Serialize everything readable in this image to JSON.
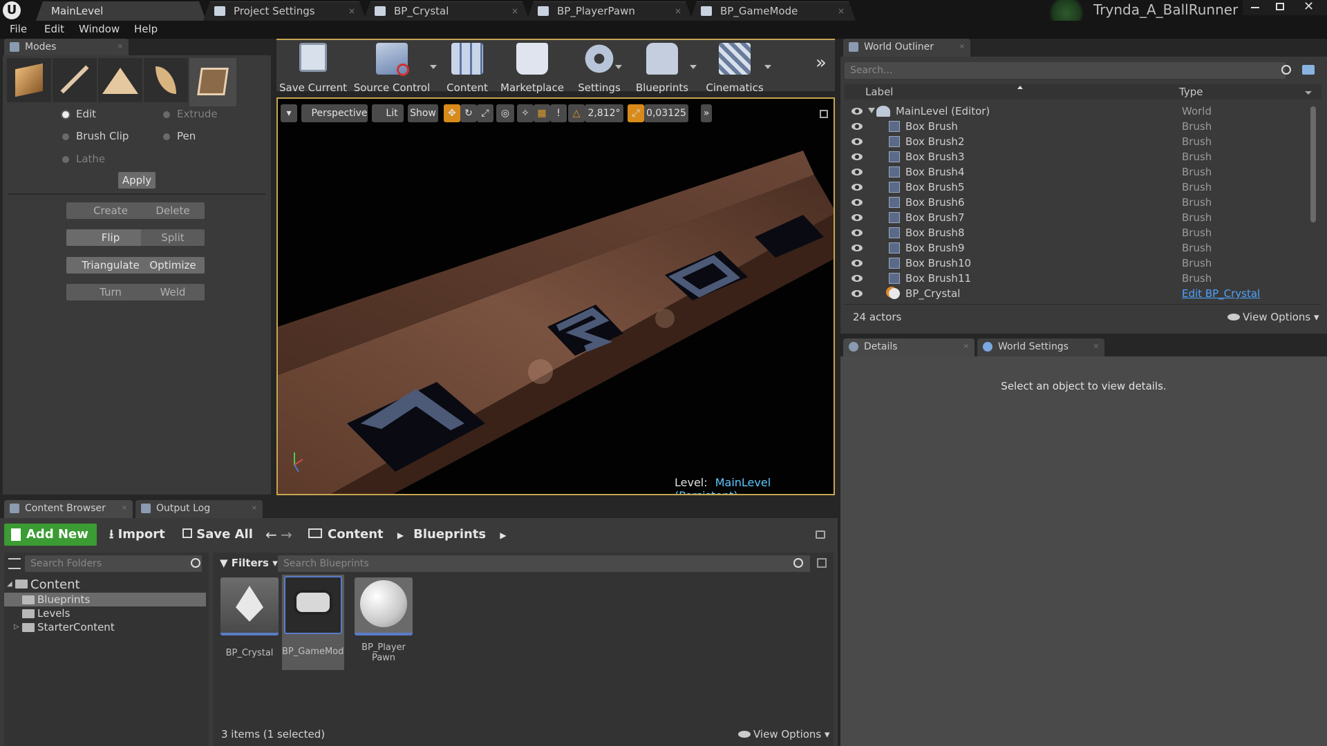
{
  "window": {
    "tabs": [
      {
        "label": "MainLevel",
        "active": true
      },
      {
        "label": "Project Settings",
        "active": false
      },
      {
        "label": "BP_Crystal",
        "active": false
      },
      {
        "label": "BP_PlayerPawn",
        "active": false
      },
      {
        "label": "BP_GameMode",
        "active": false
      }
    ],
    "project_name": "Trynda_A_BallRunner"
  },
  "menu": [
    "File",
    "Edit",
    "Window",
    "Help"
  ],
  "modes": {
    "tab_label": "Modes",
    "mode_icons": [
      "placement-mode-icon",
      "paint-mode-icon",
      "landscape-mode-icon",
      "foliage-mode-icon",
      "geometry-mode-icon"
    ],
    "radios": {
      "edit": "Edit",
      "extrude": "Extrude",
      "brush_clip": "Brush Clip",
      "pen": "Pen",
      "lathe": "Lathe"
    },
    "apply": "Apply",
    "buttons": {
      "create": "Create",
      "delete": "Delete",
      "flip": "Flip",
      "split": "Split",
      "triangulate": "Triangulate",
      "optimize": "Optimize",
      "turn": "Turn",
      "weld": "Weld"
    }
  },
  "toolbar": {
    "save_current": "Save Current",
    "source_control": "Source Control",
    "content": "Content",
    "marketplace": "Marketplace",
    "settings": "Settings",
    "blueprints": "Blueprints",
    "cinematics": "Cinematics"
  },
  "viewport": {
    "perspective": "Perspective",
    "lit": "Lit",
    "show": "Show",
    "rotation_snap": "2,812°",
    "scale_snap": "0,03125",
    "level_label": "Level:",
    "level_name": "MainLevel (Persistent)"
  },
  "outliner": {
    "tab_label": "World Outliner",
    "search_placeholder": "Search...",
    "col_label": "Label",
    "col_type": "Type",
    "root": {
      "label": "MainLevel (Editor)",
      "type": "World"
    },
    "rows": [
      {
        "label": "Box Brush",
        "type": "Brush"
      },
      {
        "label": "Box Brush2",
        "type": "Brush"
      },
      {
        "label": "Box Brush3",
        "type": "Brush"
      },
      {
        "label": "Box Brush4",
        "type": "Brush"
      },
      {
        "label": "Box Brush5",
        "type": "Brush"
      },
      {
        "label": "Box Brush6",
        "type": "Brush"
      },
      {
        "label": "Box Brush7",
        "type": "Brush"
      },
      {
        "label": "Box Brush8",
        "type": "Brush"
      },
      {
        "label": "Box Brush9",
        "type": "Brush"
      },
      {
        "label": "Box Brush10",
        "type": "Brush"
      },
      {
        "label": "Box Brush11",
        "type": "Brush"
      }
    ],
    "last_row": {
      "label": "BP_Crystal",
      "type": "Edit BP_Crystal"
    },
    "actor_count": "24 actors",
    "view_options": "View Options"
  },
  "details": {
    "tab_details": "Details",
    "tab_world_settings": "World Settings",
    "empty_message": "Select an object to view details."
  },
  "content_browser": {
    "tab_label": "Content Browser",
    "output_log": "Output Log",
    "add_new": "Add New",
    "import": "Import",
    "save_all": "Save All",
    "path": [
      "Content",
      "Blueprints"
    ],
    "search_folders": "Search Folders",
    "filters": "Filters",
    "search_blueprints": "Search Blueprints",
    "folders": {
      "root": "Content",
      "blueprints": "Blueprints",
      "levels": "Levels",
      "starter": "StarterContent"
    },
    "assets": [
      {
        "name": "BP_Crystal",
        "selected": false
      },
      {
        "name": "BP_GameMode",
        "selected": true
      },
      {
        "name": "BP_Player Pawn",
        "selected": false
      }
    ],
    "status": "3 items (1 selected)",
    "view_options": "View Options"
  },
  "colors": {
    "accent_green": "#3a9c32",
    "selection_gold": "#c8a650",
    "link_blue": "#4ea3ff",
    "panel": "#3a3a3a"
  }
}
